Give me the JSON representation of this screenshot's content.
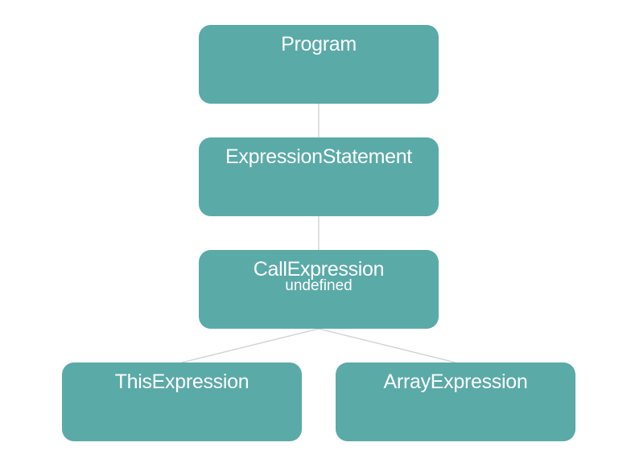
{
  "tree": {
    "program": {
      "label": "Program"
    },
    "expression_statement": {
      "label": "ExpressionStatement"
    },
    "call_expression": {
      "label": "CallExpression",
      "sub": "undefined"
    },
    "this_expression": {
      "label": "ThisExpression"
    },
    "array_expression": {
      "label": "ArrayExpression"
    }
  },
  "colors": {
    "node_fill": "#5aaaa8",
    "node_text": "#ffffff",
    "edge": "#d0d0d0",
    "background": "#ffffff"
  }
}
